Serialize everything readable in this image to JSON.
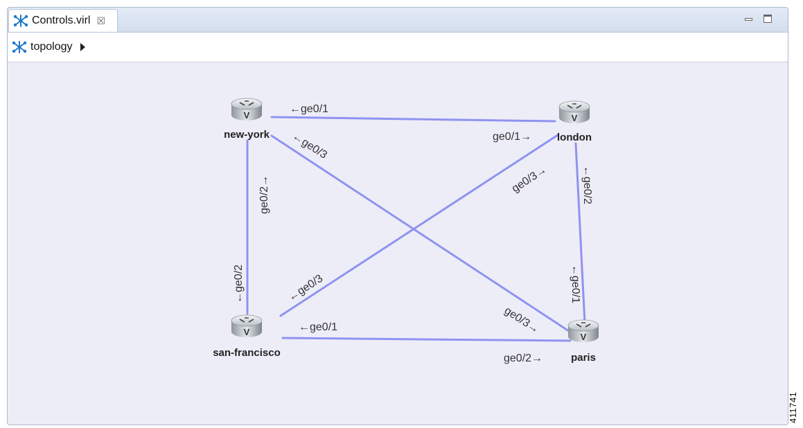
{
  "tab": {
    "label": "Controls.virl",
    "icon": "topology-icon",
    "close_icon": "close-icon"
  },
  "window_controls": {
    "minimize": "minimize-icon",
    "maximize": "maximize-icon"
  },
  "breadcrumb": {
    "label": "topology",
    "icon": "topology-icon",
    "arrow": "triangle-right-icon"
  },
  "nodes": [
    {
      "id": "new-york",
      "label": "new-york",
      "icon": "router-icon"
    },
    {
      "id": "london",
      "label": "london",
      "icon": "router-icon"
    },
    {
      "id": "san-francisco",
      "label": "san-francisco",
      "icon": "router-icon"
    },
    {
      "id": "paris",
      "label": "paris",
      "icon": "router-icon"
    }
  ],
  "links": [
    {
      "from": "new-york",
      "to": "london",
      "from_label": "ge0/1→",
      "to_label": "←ge0/1"
    },
    {
      "from": "new-york",
      "to": "paris",
      "from_label": "←ge0/3",
      "to_label": "ge0/3→"
    },
    {
      "from": "new-york",
      "to": "san-francisco",
      "from_label": "ge0/2→",
      "to_label": "←ge0/2"
    },
    {
      "from": "london",
      "to": "san-francisco",
      "from_label": "ge0/3→",
      "to_label": "←ge0/3"
    },
    {
      "from": "london",
      "to": "paris",
      "from_label": "←ge0/2",
      "to_label": "←ge0/1"
    },
    {
      "from": "san-francisco",
      "to": "paris",
      "from_label": "←ge0/1",
      "to_label": "ge0/2→"
    }
  ],
  "figure_id": "411741",
  "colors": {
    "link": "#8f93ef",
    "canvas": "#ededf8",
    "tabbar": "#d3deee"
  }
}
